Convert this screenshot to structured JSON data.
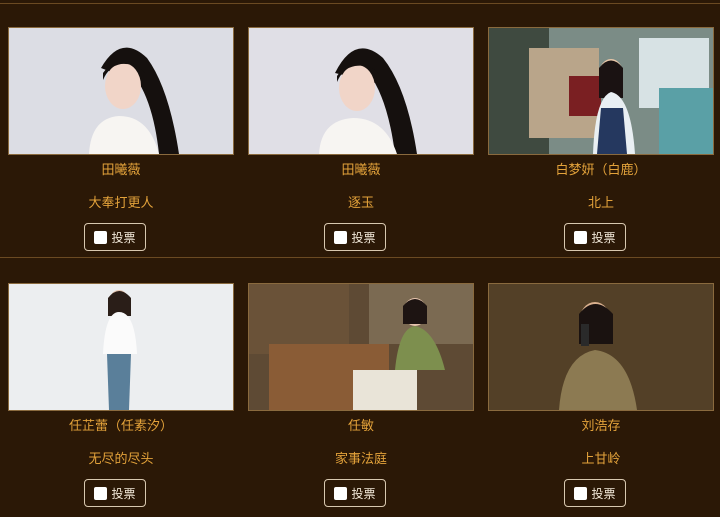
{
  "cards": [
    {
      "name": "田曦薇",
      "show": "大奉打更人",
      "vote_label": "投票"
    },
    {
      "name": "田曦薇",
      "show": "逐玉",
      "vote_label": "投票"
    },
    {
      "name": "白梦妍（白鹿）",
      "show": "北上",
      "vote_label": "投票"
    },
    {
      "name": "任芷蕾（任素汐）",
      "show": "无尽的尽头",
      "vote_label": "投票"
    },
    {
      "name": "任敏",
      "show": "家事法庭",
      "vote_label": "投票"
    },
    {
      "name": "刘浩存",
      "show": "上甘岭",
      "vote_label": "投票"
    }
  ],
  "colors": {
    "background": "#2b1806",
    "accent": "#e3a23a",
    "border": "#8a6a3e"
  }
}
